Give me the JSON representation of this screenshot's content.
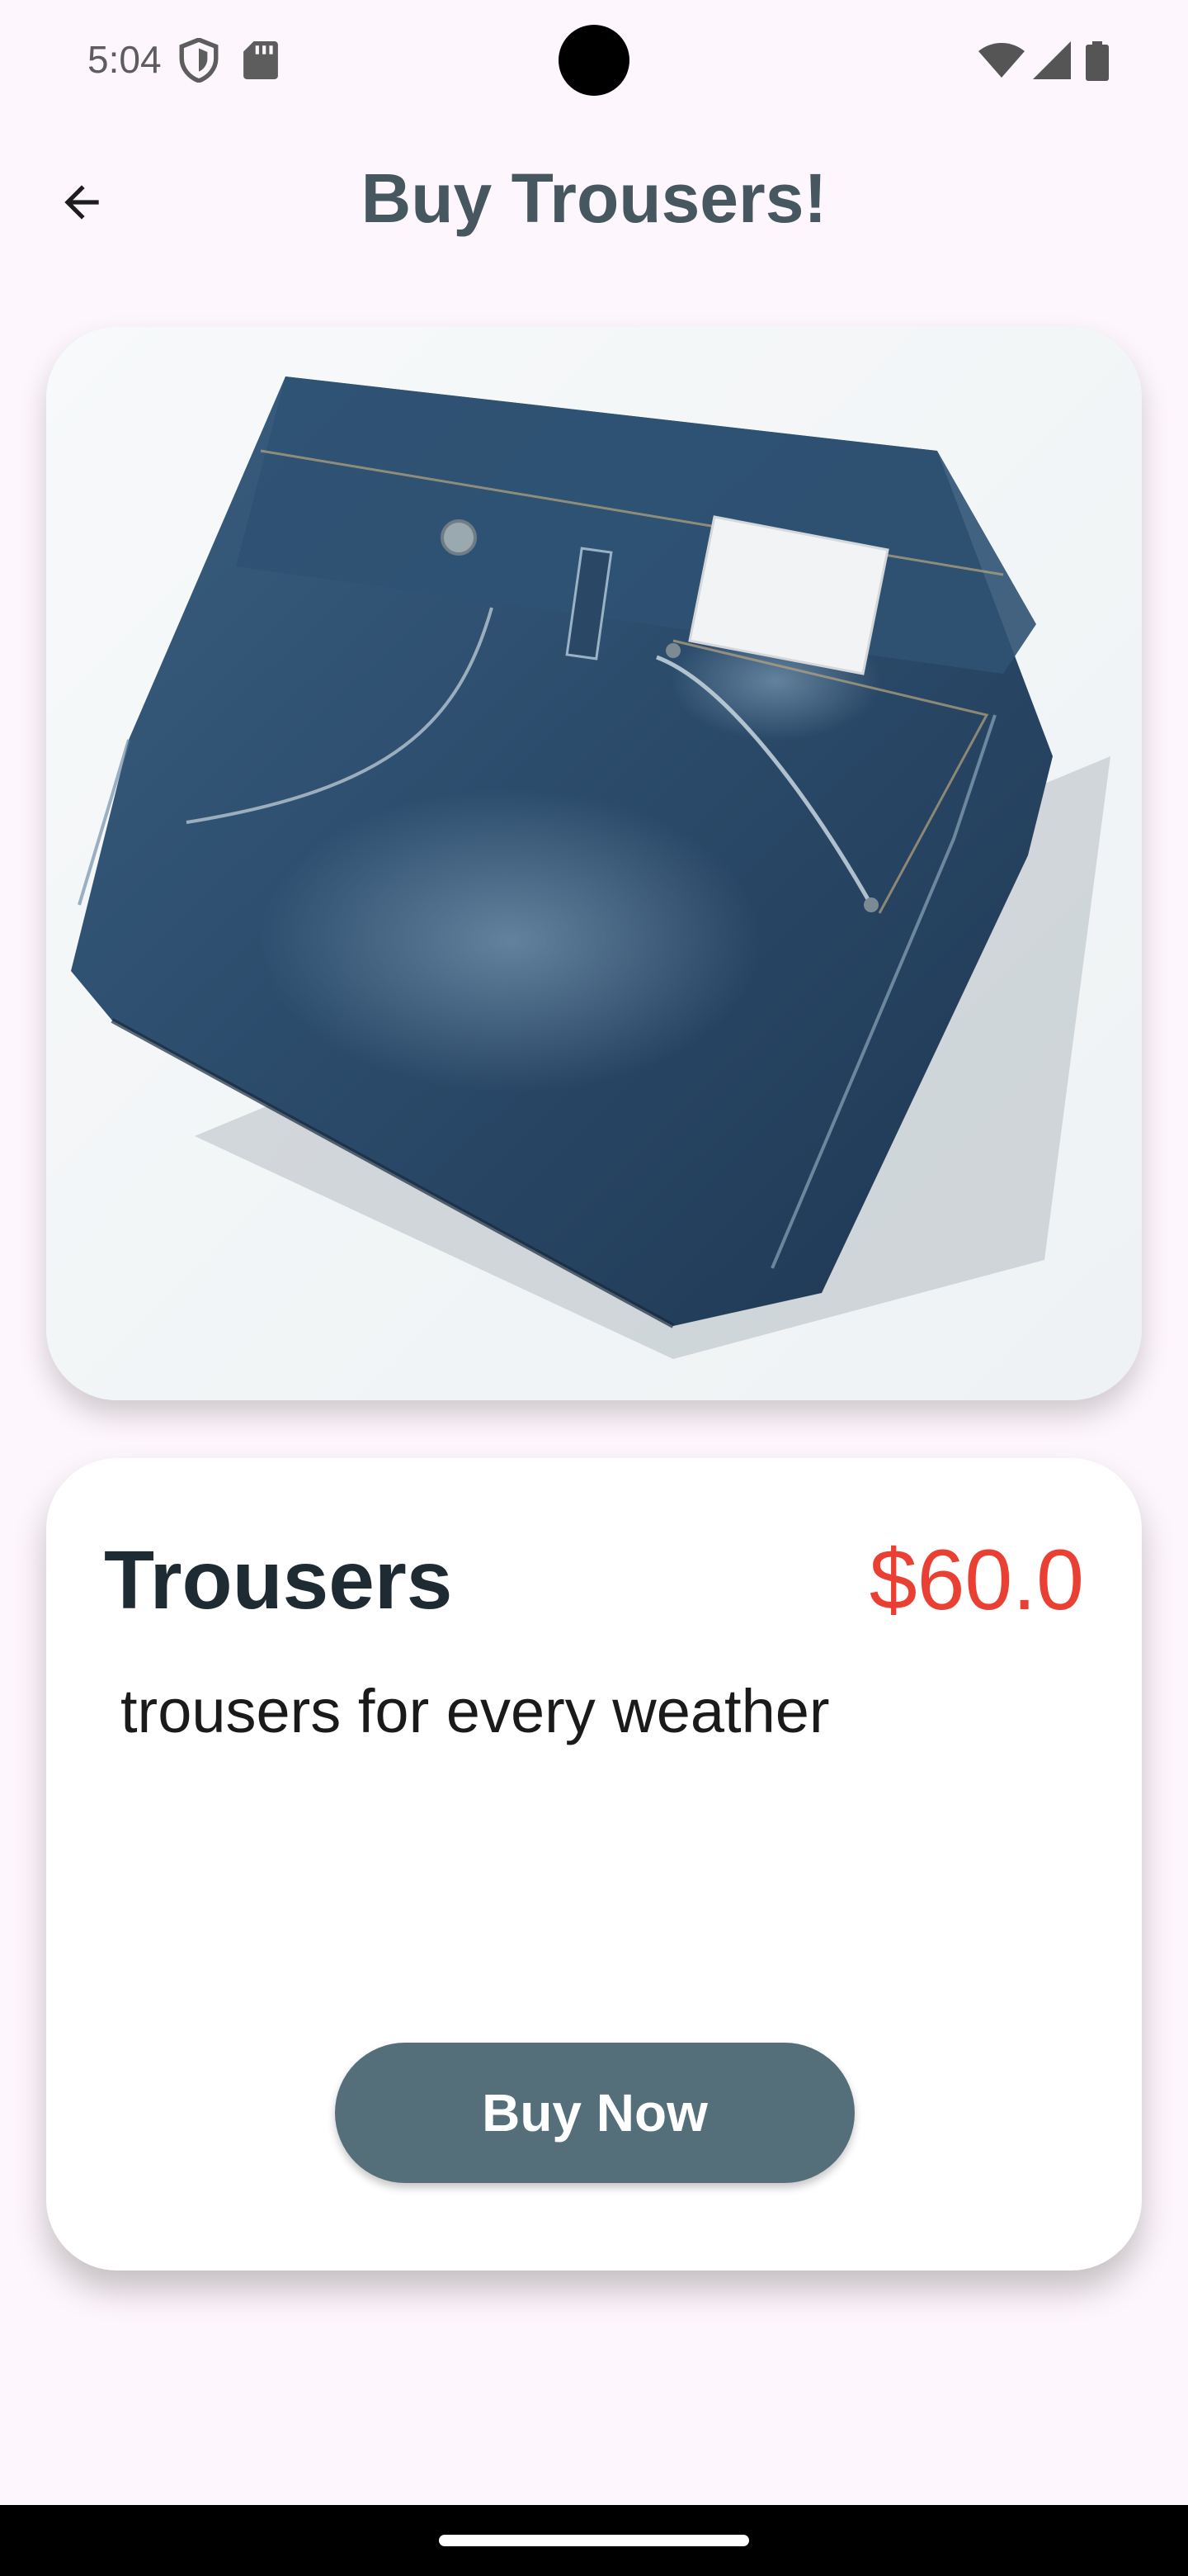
{
  "status_bar": {
    "time": "5:04",
    "icons": [
      "shield-icon",
      "sd-card-icon",
      "wifi-icon",
      "signal-icon",
      "battery-icon"
    ]
  },
  "app_bar": {
    "title": "Buy Trousers!",
    "back_icon": "arrow-left-icon"
  },
  "product": {
    "image": "folded-denim-jeans",
    "name": "Trousers",
    "price": "$60.0",
    "description": "trousers for every weather",
    "buy_label": "Buy Now"
  },
  "colors": {
    "background": "#fdf6fc",
    "title": "#46575f",
    "price": "#ea3f33",
    "button": "#546e7a",
    "button_text": "#ffffff"
  }
}
